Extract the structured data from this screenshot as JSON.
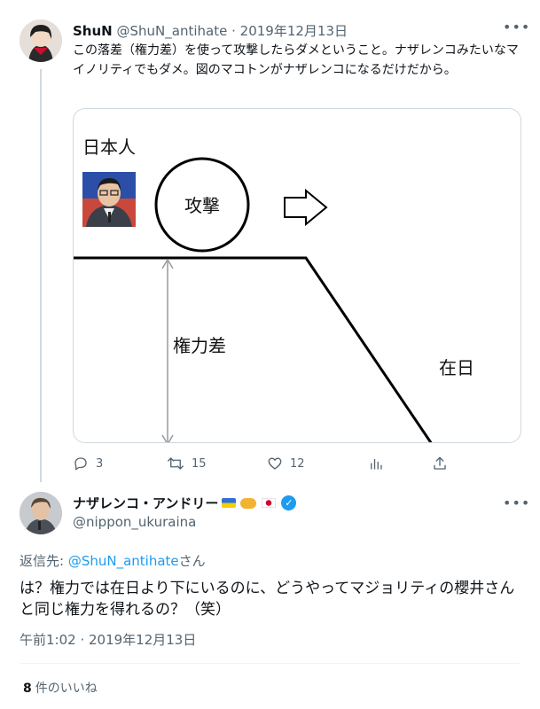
{
  "tweet1": {
    "display_name": "ShuN",
    "handle": "@ShuN_antihate",
    "separator": "·",
    "date": "2019年12月13日",
    "text": "この落差（権力差）を使って攻撃したらダメということ。ナザレンコみたいなマイノリティでもダメ。図のマコトンがナザレンコになるだけだから。",
    "diagram": {
      "label_japanese": "日本人",
      "label_attack": "攻撃",
      "label_power_gap": "権力差",
      "label_zainichi": "在日"
    },
    "actions": {
      "reply_count": "3",
      "retweet_count": "15",
      "like_count": "12"
    },
    "icons": [
      "more-icon",
      "reply-icon",
      "retweet-icon",
      "like-icon",
      "analytics-icon",
      "share-icon"
    ]
  },
  "tweet2": {
    "display_name": "ナザレンコ・アンドリー",
    "handle": "@nippon_ukuraina",
    "reply_prefix": "返信先: ",
    "reply_target": "@ShuN_antihate",
    "reply_suffix": "さん",
    "text": "は？権力では在日より下にいるのに、どうやってマジョリティの櫻井さんと同じ権力を得れるの？（笑）",
    "timestamp": "午前1:02 · 2019年12月13日",
    "likes_count": "8",
    "likes_label": "件のいいね",
    "icons": [
      "ukraine-flag-icon",
      "handshake-icon",
      "japan-flag-icon",
      "verified-icon",
      "more-icon"
    ]
  },
  "colors": {
    "text": "#0f1419",
    "muted": "#536471",
    "link": "#1d9bf0",
    "border": "#cfd9de"
  }
}
